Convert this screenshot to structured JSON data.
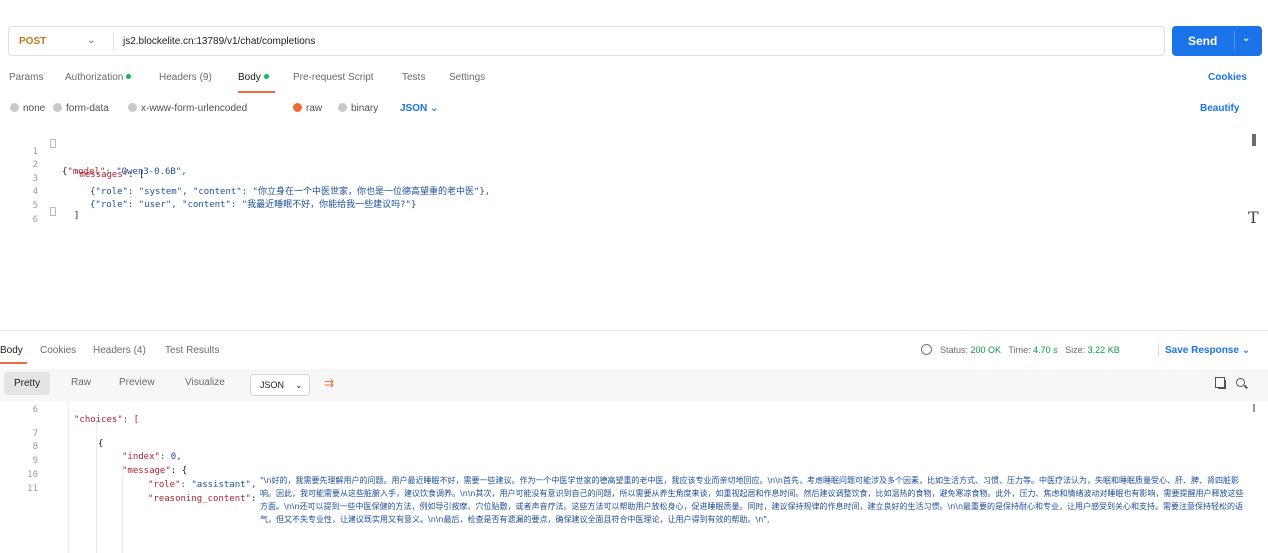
{
  "request": {
    "method": "POST",
    "url": "js2.blockelite.cn:13789/v1/chat/completions",
    "send_label": "Send"
  },
  "tabs": [
    {
      "label": "Params",
      "dot": false
    },
    {
      "label": "Authorization",
      "dot": true
    },
    {
      "label": "Headers (9)",
      "dot": false
    },
    {
      "label": "Body",
      "dot": true
    },
    {
      "label": "Pre-request Script",
      "dot": false
    },
    {
      "label": "Tests",
      "dot": false
    },
    {
      "label": "Settings",
      "dot": false
    }
  ],
  "cookies_label": "Cookies",
  "body_types": [
    "none",
    "form-data",
    "x-www-form-urlencoded",
    "raw",
    "binary"
  ],
  "selected_body_type": "raw",
  "body_format": "JSON",
  "beautify_label": "Beautify",
  "editor": {
    "lines": [
      {
        "n": "1",
        "key": "\"model\"",
        "rest": ": \"Qwen3-0.6B\","
      },
      {
        "n": "2",
        "key": "\"messages\"",
        "rest": ": ["
      },
      {
        "n": "3",
        "text": "{\"role\": \"system\", \"content\": \"你立身在一个中医世家，你也是一位德高望重的老中医\"},"
      },
      {
        "n": "4",
        "text": "{\"role\": \"user\", \"content\": \"我最近睡眠不好，你能给我一些建议吗?\"}"
      },
      {
        "n": "5",
        "text": "]"
      },
      {
        "n": "6",
        "text": ""
      }
    ]
  },
  "response": {
    "tabs": [
      "Body",
      "Cookies",
      "Headers (4)",
      "Test Results"
    ],
    "status_label": "Status:",
    "status_value": "200 OK",
    "time_label": "Time:",
    "time_value": "4.70 s",
    "size_label": "Size:",
    "size_value": "3.22 KB",
    "save_label": "Save Response",
    "views": [
      "Pretty",
      "Raw",
      "Preview",
      "Visualize"
    ],
    "format": "JSON",
    "lines": [
      {
        "n": "6",
        "text": "\"choices\": ["
      },
      {
        "n": "7",
        "text": "{"
      },
      {
        "n": "8",
        "key": "\"index\"",
        "rest": ": 0,"
      },
      {
        "n": "9",
        "key": "\"message\"",
        "rest": ": {"
      },
      {
        "n": "10",
        "key": "\"role\"",
        "rest": ": \"assistant\","
      },
      {
        "n": "11",
        "key": "\"reasoning_content\"",
        "rest": ":"
      }
    ],
    "reasoning_text": "\"\\n好的，我需要先理解用户的问题。用户最近睡眠不好，需要一些建议。作为一个中医学世家的德高望重的老中医，我应该专业而亲切地回应。\\n\\n首先，考虑睡眠问题可能涉及多个因素，比如生活方式、习惯、压力等。中医疗法认为，失眠和睡眠质量受心、肝、脾、肾四脏影响。因此，我可能需要从这些脏腑入手，建议饮食调养。\\n\\n其次，用户可能没有意识到自己的问题，所以需要从养生角度来谈，如重视起居和作息时间。然后建议调整饮食，比如温热的食物，避免寒凉食物。此外，压力、焦虑和情绪波动对睡眠也有影响，需要提醒用户释放这些方面。\\n\\n还可以提到一些中医保健的方法，例如导引按摩、穴位贴敷，或者声音疗法。这些方法可以帮助用户放松身心，促进睡眠质量。同时，建议保持规律的作息时间，建立良好的生活习惯。\\n\\n最重要的是保持耐心和专业，让用户感受到关心和支持。需要注意保持轻松的语气，但又不失专业性，让建议既实用又有意义。\\n\\n最后，检查是否有遗漏的要点，确保建议全面且符合中医理论，让用户得到有效的帮助。\\n\","
  }
}
